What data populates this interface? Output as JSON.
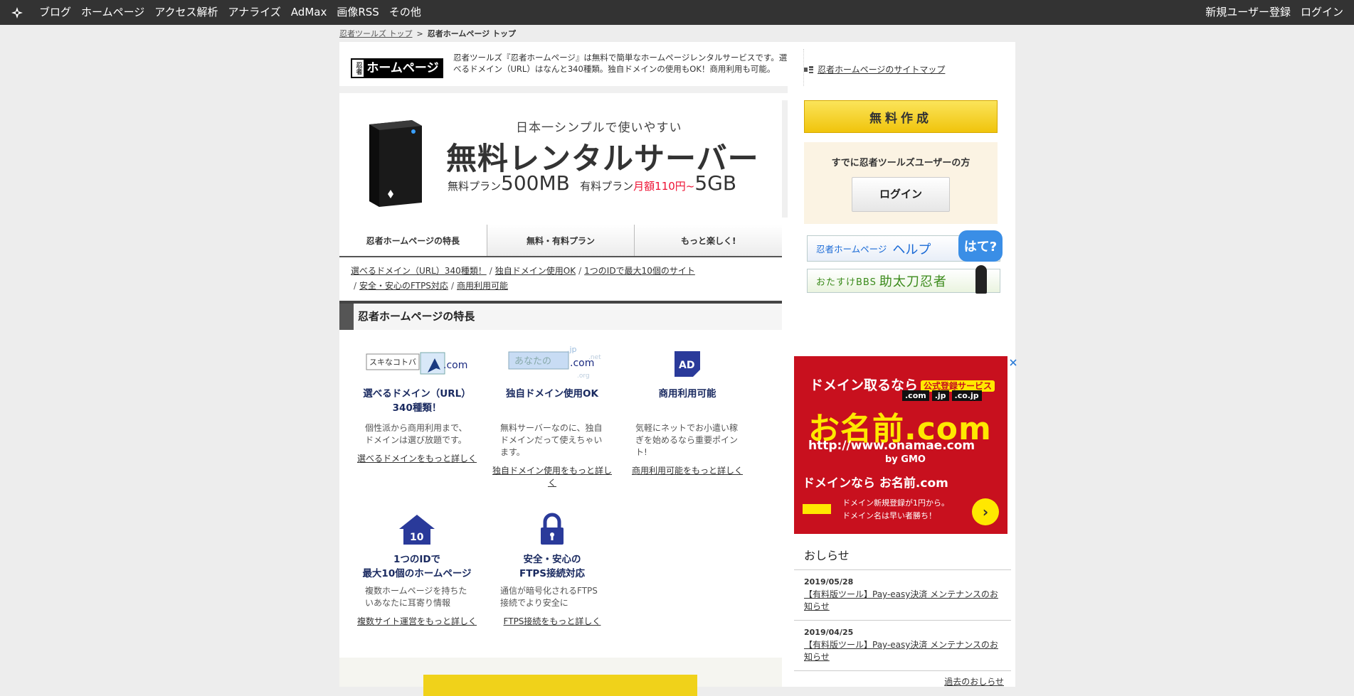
{
  "topbar": {
    "nav": [
      "ブログ",
      "ホームページ",
      "アクセス解析",
      "アナライズ",
      "AdMax",
      "画像RSS",
      "その他"
    ],
    "right": [
      "新規ユーザー登録",
      "ログイン"
    ]
  },
  "breadcrumb": {
    "root": "忍者ツールズ トップ",
    "current": "忍者ホームページ トップ"
  },
  "header": {
    "brand_small": "忍者",
    "brand_main": "ホームページ",
    "description": "忍者ツールズ『忍者ホームページ』は無料で簡単なホームページレンタルサービスです。選べるドメイン（URL）はなんと340種類。独自ドメインの使用もOK！商用利用も可能。",
    "sitemap_link": "忍者ホームページのサイトマップ"
  },
  "banner": {
    "tagline": "日本一シンプルで使いやすい",
    "headline": "無料レンタルサーバー",
    "free_label": "無料プラン",
    "free_size": "500MB",
    "paid_label": "有料プラン",
    "paid_price": "月額110円~",
    "paid_size": "5GB"
  },
  "tabs": [
    "忍者ホームページの特長",
    "無料・有料プラン",
    "もっと楽しく!"
  ],
  "sublinks": [
    "選べるドメイン（URL）340種類！",
    "独自ドメイン使用OK",
    "1つのIDで最大10個のサイト",
    "安全・安心のFTPS対応",
    "商用利用可能"
  ],
  "features": {
    "title": "忍者ホームページの特長",
    "items": [
      {
        "name_line1": "選べるドメイン（URL）",
        "name_line2": "340種類！",
        "text": "個性派から商用利用まで、ドメインは選び放題です。",
        "more": "選べるドメインをもっと詳しく",
        "icon_text1": "スキなコトバ",
        "icon_text2": ".com"
      },
      {
        "name_line1": "独自ドメイン使用OK",
        "name_line2": "",
        "text": "無料サーバーなのに、独自ドメインだって使えちゃいます。",
        "more": "独自ドメイン使用をもっと詳しく",
        "icon_text1": "あなたの",
        "icon_text2": ".com",
        "icon_text3": ".jp",
        "icon_text4": ".net",
        "icon_text5": ".org"
      },
      {
        "name_line1": "商用利用可能",
        "name_line2": "",
        "text": "気軽にネットでお小遣い稼ぎを始めるなら重要ポイント!",
        "more": "商用利用可能をもっと詳しく",
        "icon_text1": "AD"
      },
      {
        "name_line1": "1つのIDで",
        "name_line2": "最大10個のホームページ",
        "text": "複数ホームページを持ちたいあなたに耳寄り情報",
        "more": "複数サイト運営をもっと詳しく",
        "icon_text1": "10"
      },
      {
        "name_line1": "安全・安心の",
        "name_line2": "FTPS接続対応",
        "text": "通信が暗号化されるFTPS接続でより安全に",
        "more": "FTPS接続をもっと詳しく"
      }
    ]
  },
  "sidebar": {
    "free_button": "無料作成",
    "login_title": "すでに忍者ツールズユーザーの方",
    "login_button": "ログイン",
    "help_small": "忍者ホームページ",
    "help_big": "ヘルプ",
    "help_badge": "はて?",
    "bbs_small": "おたすけBBS",
    "bbs_big": "助太刀忍者"
  },
  "ad": {
    "head": "ドメイン取るなら",
    "pill": "公式登録サービス",
    "doms": [
      ".com",
      ".jp",
      ".co.jp"
    ],
    "name": "お名前.com",
    "url": "http://www.onamae.com",
    "gmo": "by GMO",
    "sub": "ドメインなら お名前.com",
    "small1": "ドメイン新規登録が1円から。",
    "small2": "ドメイン名は早い者勝ち！"
  },
  "news": {
    "title": "おしらせ",
    "items": [
      {
        "date": "2019/05/28",
        "text": "【有料版ツール】Pay-easy決済 メンテナンスのお知らせ"
      },
      {
        "date": "2019/04/25",
        "text": "【有料版ツール】Pay-easy決済 メンテナンスのお知らせ"
      }
    ],
    "past": "過去のおしらせ"
  }
}
